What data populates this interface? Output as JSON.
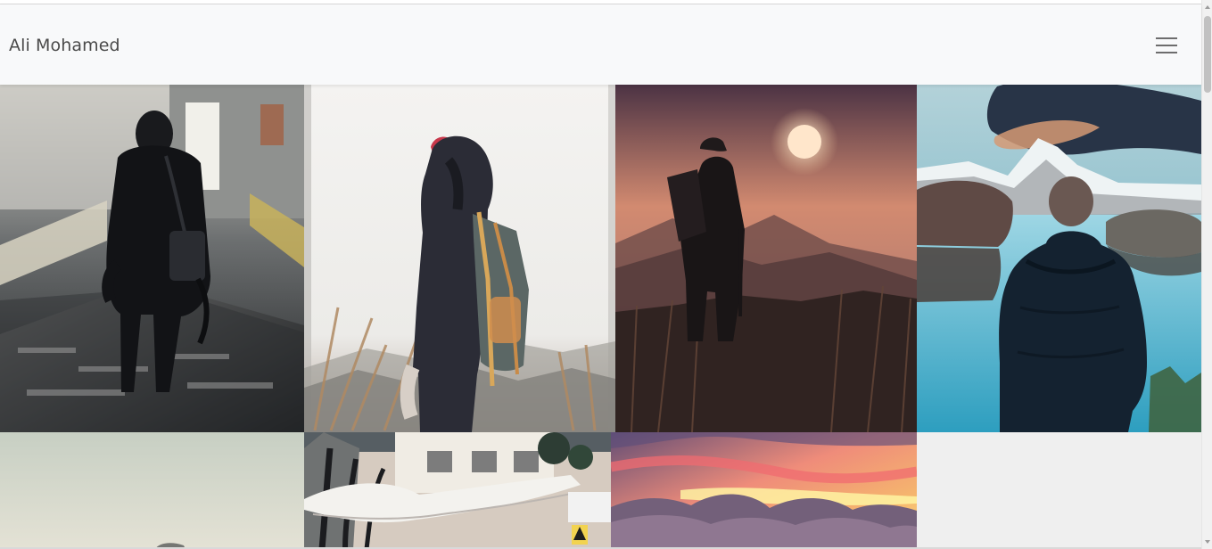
{
  "navbar": {
    "brand": "Ali Mohamed",
    "menu_icon": "hamburger-menu-icon"
  },
  "gallery": {
    "items": [
      {
        "semantic": "hooded-person-walking-on-wet-bridge-photo"
      },
      {
        "semantic": "person-with-backpack-red-cap-photo"
      },
      {
        "semantic": "hiker-silhouette-at-sunset-photo"
      },
      {
        "semantic": "man-looking-at-mountain-lake-photo"
      },
      {
        "semantic": "hazy-sky-partial-photo"
      },
      {
        "semantic": "street-canopy-and-buildings-photo"
      },
      {
        "semantic": "sunset-cloudscape-photo"
      },
      {
        "semantic": "blank-light-gray-tile"
      }
    ]
  },
  "colors": {
    "navbar_bg": "#f8f9fa",
    "brand_text": "#4a4a4a",
    "gallery_empty_tile": "#efefef"
  }
}
